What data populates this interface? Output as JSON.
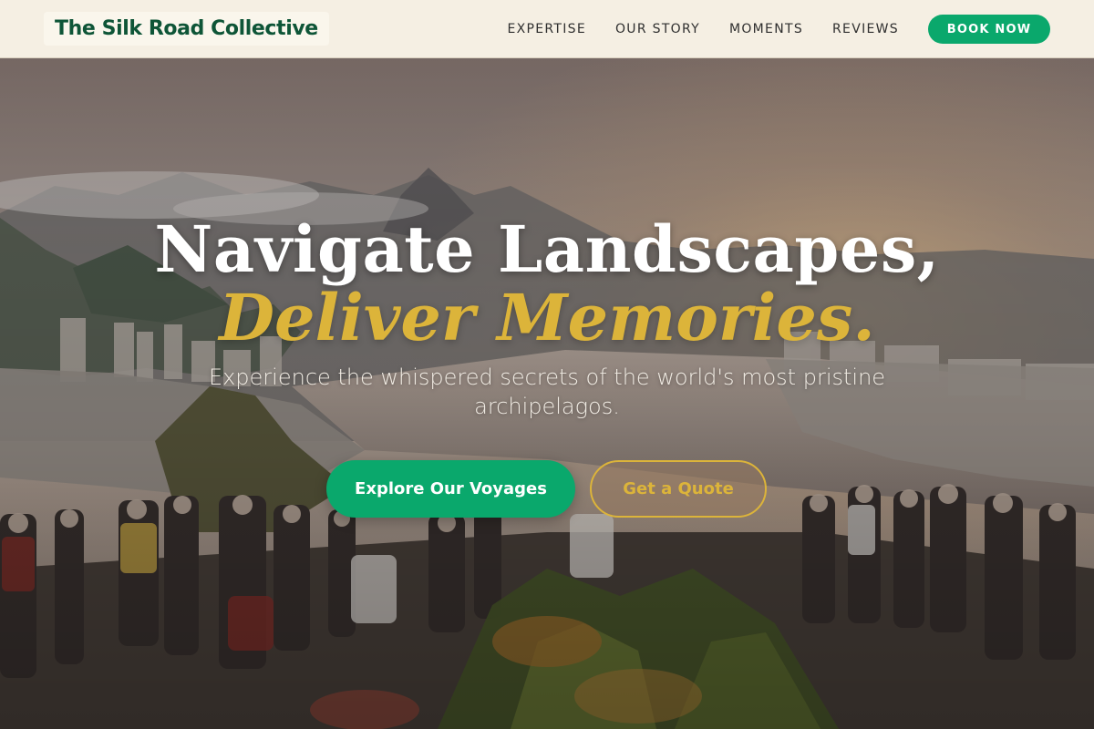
{
  "header": {
    "logo_text": "The Silk Road Collective",
    "nav": [
      {
        "label": "EXPERTISE"
      },
      {
        "label": "OUR STORY"
      },
      {
        "label": "MOMENTS"
      },
      {
        "label": "REVIEWS"
      }
    ],
    "book_label": "BOOK NOW"
  },
  "hero": {
    "headline_line1": "Navigate Landscapes,",
    "headline_line2": "Deliver Memories.",
    "subtitle": "Experience the whispered secrets of the world's most pristine archipelagos.",
    "primary_cta": "Explore Our Voyages",
    "secondary_cta": "Get a Quote",
    "background_description": "Scenic overlook at dusk: crowd of travelers at a railed viewpoint above a bay city, misty mountains, tropical plants in foreground"
  },
  "colors": {
    "nav_background": "#f5efe3",
    "brand_green": "#0e5537",
    "accent_green": "#0aa86c",
    "accent_gold": "#dcb43a",
    "headline_white": "#ffffff"
  }
}
